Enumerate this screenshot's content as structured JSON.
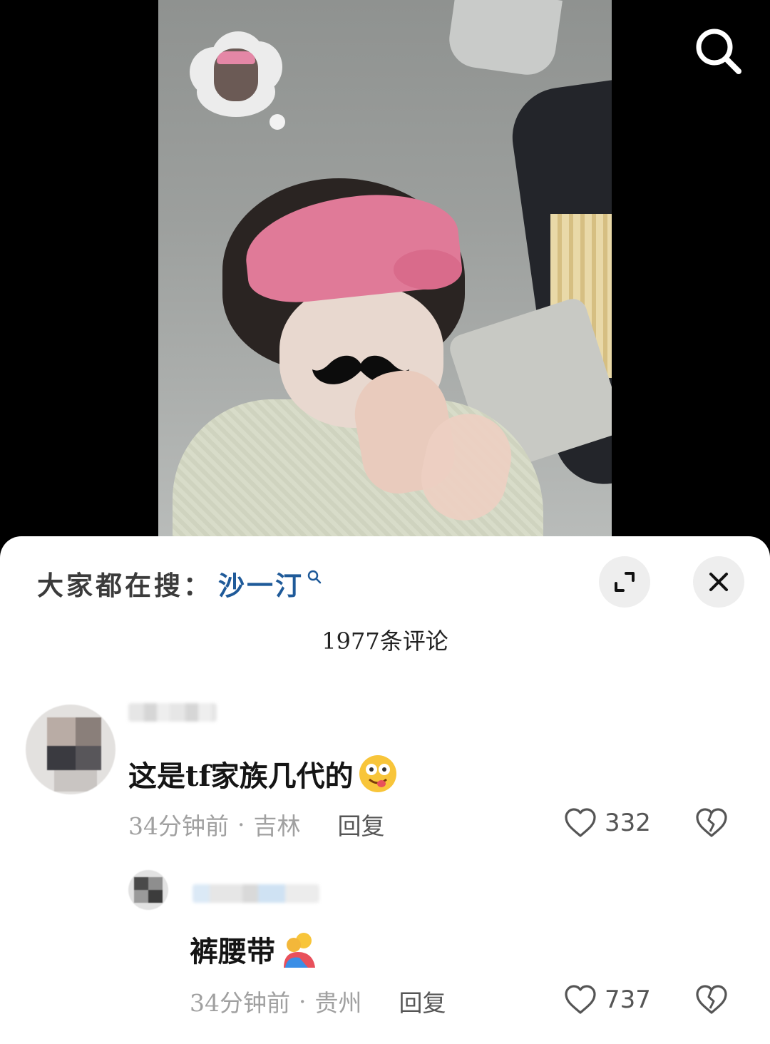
{
  "hot_search": {
    "prefix": "大家都在搜：",
    "term": "沙一汀"
  },
  "comments_header": {
    "count_label": "1977条评论"
  },
  "comments": [
    {
      "text": "这是tf家族几代的",
      "emoji": "drooling-face-emoji",
      "time": "34分钟前",
      "location": "吉林",
      "reply_label": "回复",
      "likes": "332"
    },
    {
      "text": "裤腰带",
      "emoji": "hugging-people-emoji",
      "time": "34分钟前",
      "location": "贵州",
      "reply_label": "回复",
      "likes": "737"
    }
  ],
  "icons": {
    "search": "search-icon",
    "expand": "expand-icon",
    "close": "close-icon",
    "like": "heart-icon",
    "dislike": "broken-heart-icon"
  },
  "colors": {
    "hot_term": "#1f5a99",
    "sheet_bg": "#ffffff",
    "meta_text": "#a0a0a0"
  }
}
